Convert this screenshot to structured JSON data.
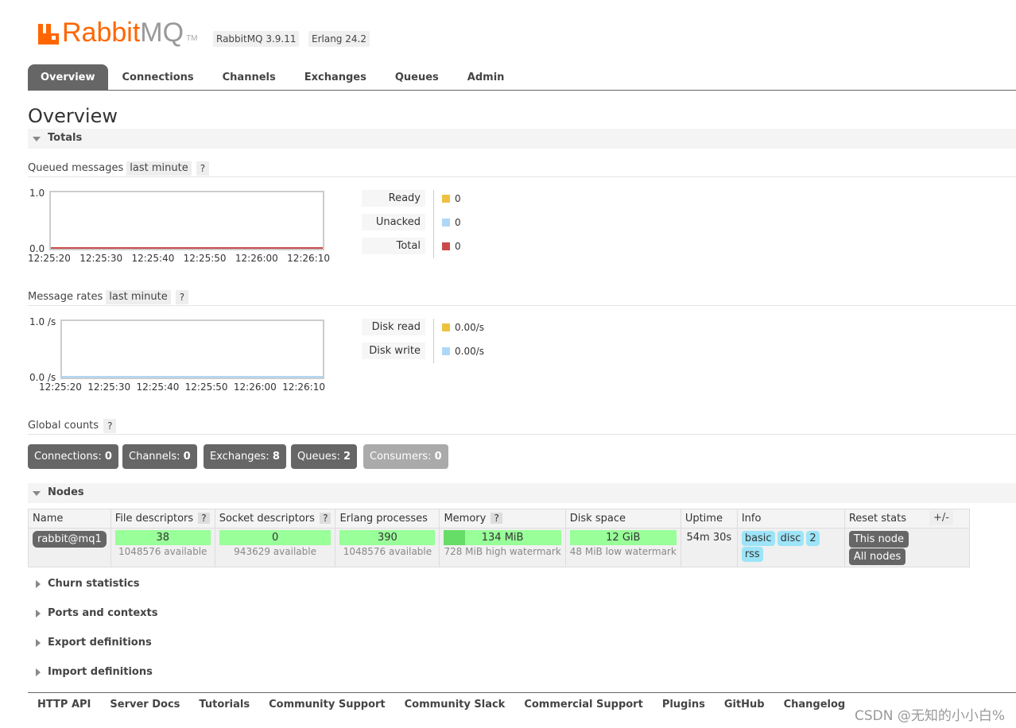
{
  "header": {
    "logo_text_rabbit": "Rabbit",
    "logo_text_mq": "MQ",
    "logo_tm": "TM",
    "version": "RabbitMQ 3.9.11",
    "erlang": "Erlang 24.2"
  },
  "tabs": [
    {
      "label": "Overview",
      "active": true
    },
    {
      "label": "Connections"
    },
    {
      "label": "Channels"
    },
    {
      "label": "Exchanges"
    },
    {
      "label": "Queues"
    },
    {
      "label": "Admin"
    }
  ],
  "page_title": "Overview",
  "totals": {
    "section_label": "Totals",
    "queued": {
      "label": "Queued messages",
      "range": "last minute",
      "help": "?",
      "y_max": "1.0",
      "y_min": "0.0",
      "x_ticks": [
        "12:25:20",
        "12:25:30",
        "12:25:40",
        "12:25:50",
        "12:26:00",
        "12:26:10"
      ],
      "legend": [
        {
          "label": "Ready",
          "value": "0",
          "color": "#edc240"
        },
        {
          "label": "Unacked",
          "value": "0",
          "color": "#afd8f8"
        },
        {
          "label": "Total",
          "value": "0",
          "color": "#cb4b4b"
        }
      ]
    },
    "rates": {
      "label": "Message rates",
      "range": "last minute",
      "help": "?",
      "y_max": "1.0 /s",
      "y_min": "0.0 /s",
      "x_ticks": [
        "12:25:20",
        "12:25:30",
        "12:25:40",
        "12:25:50",
        "12:26:00",
        "12:26:10"
      ],
      "legend": [
        {
          "label": "Disk read",
          "value": "0.00/s",
          "color": "#edc240"
        },
        {
          "label": "Disk write",
          "value": "0.00/s",
          "color": "#afd8f8"
        }
      ]
    },
    "global": {
      "label": "Global counts",
      "help": "?",
      "counts": [
        {
          "label": "Connections:",
          "value": "0"
        },
        {
          "label": "Channels:",
          "value": "0"
        },
        {
          "label": "Exchanges:",
          "value": "8"
        },
        {
          "label": "Queues:",
          "value": "2"
        },
        {
          "label": "Consumers:",
          "value": "0"
        }
      ]
    }
  },
  "nodes": {
    "section_label": "Nodes",
    "plusminus": "+/-",
    "help": "?",
    "columns": [
      "Name",
      "File descriptors",
      "Socket descriptors",
      "Erlang processes",
      "Memory",
      "Disk space",
      "Uptime",
      "Info",
      "Reset stats"
    ],
    "row": {
      "name": "rabbit@mq1",
      "fd": "38",
      "fd_avail": "1048576 available",
      "sd": "0",
      "sd_avail": "943629 available",
      "erl": "390",
      "erl_avail": "1048576 available",
      "memory": "134 MiB",
      "memory_sub": "728 MiB high watermark",
      "memory_fraction": 0.18,
      "disk": "12 GiB",
      "disk_sub": "48 MiB low watermark",
      "uptime": "54m 30s",
      "info": [
        "basic",
        "disc",
        "2",
        "rss"
      ],
      "reset": [
        "This node",
        "All nodes"
      ]
    }
  },
  "collapsed_sections": [
    "Churn statistics",
    "Ports and contexts",
    "Export definitions",
    "Import definitions"
  ],
  "footer": [
    "HTTP API",
    "Server Docs",
    "Tutorials",
    "Community Support",
    "Community Slack",
    "Commercial Support",
    "Plugins",
    "GitHub",
    "Changelog"
  ],
  "watermark": "CSDN @无知的小小白%"
}
